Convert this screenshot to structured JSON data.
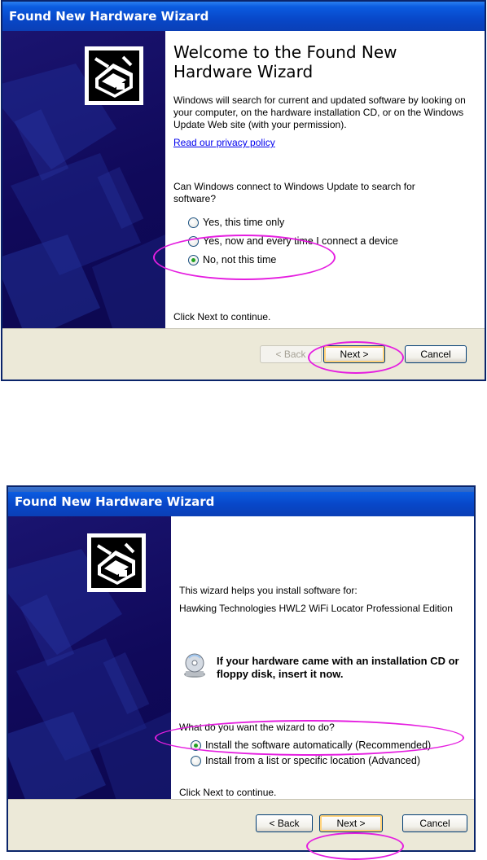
{
  "wizard1": {
    "title": "Found New Hardware Wizard",
    "heading": "Welcome to the Found New Hardware Wizard",
    "intro": "Windows will search for current and updated software by looking on your computer, on the hardware installation CD, or on the Windows Update Web site (with your permission).",
    "privacy_link": "Read our privacy policy",
    "question": "Can Windows connect to Windows Update to search for software?",
    "options": [
      {
        "label": "Yes, this time only",
        "selected": false
      },
      {
        "label": "Yes, now and every time I connect a device",
        "selected": false
      },
      {
        "label": "No, not this time",
        "selected": true
      }
    ],
    "continue_text": "Click Next to continue.",
    "back_label": "< Back",
    "next_label": "Next >",
    "cancel_label": "Cancel",
    "highlight_color": "#e51ee0"
  },
  "wizard2": {
    "title": "Found New Hardware Wizard",
    "intro": "This wizard helps you install software for:",
    "device": "Hawking Technologies HWL2 WiFi Locator Professional Edition",
    "cd_prompt": "If your hardware came with an installation CD or floppy disk, insert it now.",
    "cd_icon": "cd-install-icon",
    "question": "What do you want the wizard to do?",
    "options": [
      {
        "label": "Install the software automatically (Recommended)",
        "selected": true
      },
      {
        "label": "Install from a list or specific location (Advanced)",
        "selected": false
      }
    ],
    "continue_text": "Click Next to continue.",
    "back_label": "< Back",
    "next_label": "Next >",
    "cancel_label": "Cancel"
  },
  "colors": {
    "titlebar": "#0a47c8",
    "sidebar": "#10095a",
    "footer": "#ece9d8",
    "annotation": "#e51ee0"
  }
}
